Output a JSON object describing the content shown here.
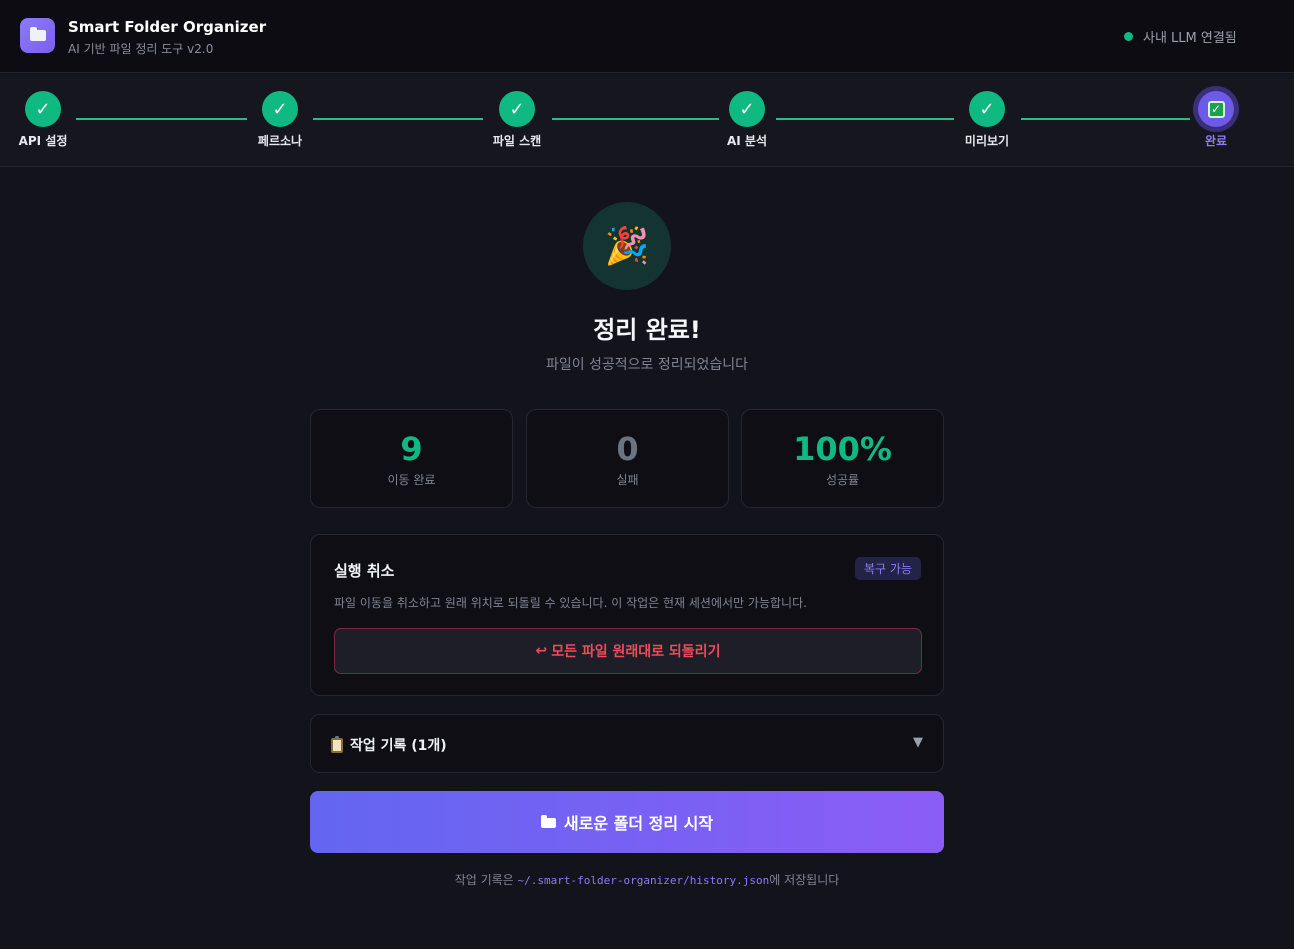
{
  "header": {
    "title": "Smart Folder Organizer",
    "subtitle": "AI 기반 파일 정리 도구 v2.0",
    "connection_status": "사내 LLM 연결됨",
    "logo_icon": "folder-icon"
  },
  "steps": [
    {
      "label": "API 설정",
      "state": "done"
    },
    {
      "label": "페르소나",
      "state": "done"
    },
    {
      "label": "파일 스캔",
      "state": "done"
    },
    {
      "label": "AI 분석",
      "state": "done"
    },
    {
      "label": "미리보기",
      "state": "done"
    },
    {
      "label": "완료",
      "state": "active"
    }
  ],
  "result": {
    "icon": "party-popper-icon",
    "title": "정리 완료!",
    "subtitle": "파일이 성공적으로 정리되었습니다"
  },
  "stats": [
    {
      "value": "9",
      "label": "이동 완료",
      "color": "#10b981"
    },
    {
      "value": "0",
      "label": "실패",
      "color": "#6b7280"
    },
    {
      "value": "100%",
      "label": "성공률",
      "color": "#10b981"
    }
  ],
  "undo": {
    "title": "실행 취소",
    "badge": "복구 가능",
    "description": "파일 이동을 취소하고 원래 위치로 되돌릴 수 있습니다. 이 작업은 현재 세션에서만 가능합니다.",
    "button_icon": "↩",
    "button_label": "모든 파일 원래대로 되돌리기"
  },
  "history": {
    "title": "작업 기록 (1개)",
    "toggle_icon": "▼"
  },
  "new_button": {
    "label": "새로운 폴더 정리 시작"
  },
  "footer": {
    "prefix": "작업 기록은 ",
    "path": "~/.smart-folder-organizer/history.json",
    "suffix": "에 저장됩니다"
  },
  "colors": {
    "accent": "#8b7cf6",
    "success": "#10b981",
    "danger": "#f04b5a"
  }
}
